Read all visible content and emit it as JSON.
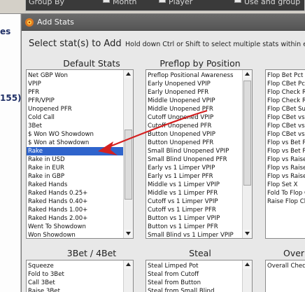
{
  "background": {
    "top_labels": [
      "Group By",
      "Month",
      "Player",
      "Use and group"
    ],
    "left_labels": [
      "es",
      "155)"
    ]
  },
  "dialog": {
    "title": "Add Stats",
    "select_label": "Select stat(s) to Add",
    "hint": "Hold down Ctrl or Shift to select multiple stats within e"
  },
  "groups": {
    "default_stats": {
      "title": "Default Stats",
      "items": [
        "Net GBP Won",
        "VPIP",
        "PFR",
        "PFR/VPIP",
        "Unopened PFR",
        "Cold Call",
        "3Bet",
        "$ Won WO Showdown",
        "$ Won at Showdown",
        "Rake",
        "Rake in USD",
        "Rake in EUR",
        "Rake in GBP",
        "Raked Hands",
        "Raked Hands 0.25+",
        "Raked Hands 0.40+",
        "Raked Hands 1.00+",
        "Raked Hands 2.00+",
        "Went To Showdown",
        "Won Showdown"
      ],
      "selected": "Rake"
    },
    "preflop_by_position": {
      "title": "Preflop by Position",
      "items": [
        "Preflop Positional Awareness",
        "Early Unopened VPIP",
        "Early Unopened PFR",
        "Middle Unopened VPIP",
        "Middle Unopened PFR",
        "Cutoff Unopened VPIP",
        "Cutoff Unopened PFR",
        "Button Unopened VPIP",
        "Button Unopened PFR",
        "Small Blind Unopened VPIP",
        "Small Blind Unopened PFR",
        "Early vs 1 Limper VPIP",
        "Early vs 1 Limper PFR",
        "Middle vs 1 Limper VPIP",
        "Middle vs 1 Limper PFR",
        "Cutoff vs 1 Limper VPIP",
        "Cutoff vs 1 Limper PFR",
        "Button vs 1 Limper VPIP",
        "Button vs 1 Limper PFR",
        "Small Blind vs 1 Limper VPIP"
      ]
    },
    "flop": {
      "title": "",
      "items": [
        "Flop Bet Pct",
        "Flop CBet Pct",
        "Flop Check R",
        "Flop Check R",
        "Flop CBet Suc",
        "Flop CBet vs",
        "Flop CBet vs",
        "Flop CBet vs",
        "Flop vs Bet R",
        "Flop vs Bet R",
        "Flop vs Raise",
        "Flop vs Raise",
        "Flop vs Raise",
        "Flop Set X",
        "Fold To Flop C",
        "Raise Flop Ch"
      ]
    },
    "threebet_4bet": {
      "title": "3Bet / 4Bet",
      "items": [
        "Squeeze",
        "Fold to 3Bet",
        "Call 3Bet",
        "Raise 3Bet"
      ]
    },
    "steal": {
      "title": "Steal",
      "items": [
        "Steal Limped Pot",
        "Steal from Cutoff",
        "Steal from Button",
        "Steal from Small Blind"
      ]
    },
    "overall": {
      "title": "Over",
      "items": [
        "Overall Check"
      ]
    }
  },
  "colors": {
    "annotation_arrow": "#d42020",
    "selection": "#2f64cc"
  }
}
